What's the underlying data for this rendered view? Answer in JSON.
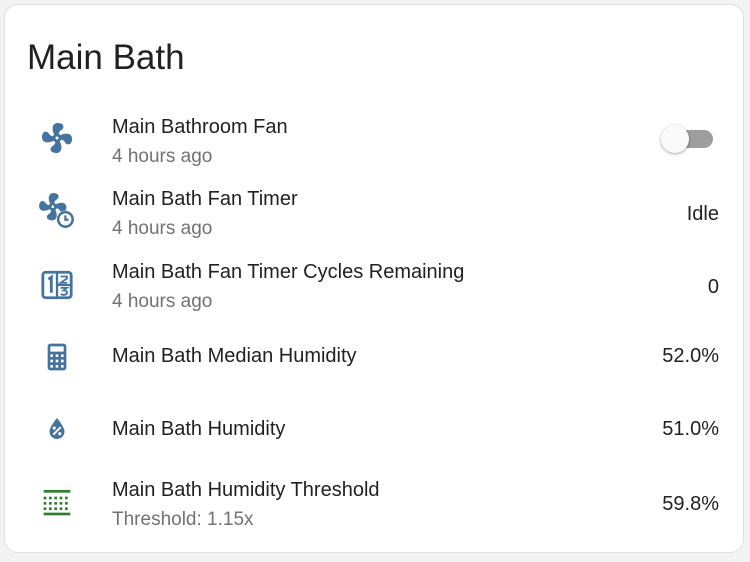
{
  "card": {
    "title": "Main Bath"
  },
  "colors": {
    "icon": "#44739e",
    "threshold_icon": "#2e7d32",
    "text_primary": "#212121",
    "text_secondary": "#727272"
  },
  "entities": [
    {
      "name": "Main Bathroom Fan",
      "secondary": "4 hours ago",
      "icon": "fan-icon",
      "toggle_on": false
    },
    {
      "name": "Main Bath Fan Timer",
      "secondary": "4 hours ago",
      "icon": "fan-clock-icon",
      "value": "Idle"
    },
    {
      "name": "Main Bath Fan Timer Cycles Remaining",
      "secondary": "4 hours ago",
      "icon": "numeric-icon",
      "value": "0"
    },
    {
      "name": "Main Bath Median Humidity",
      "icon": "calculator-icon",
      "value": "52.0%"
    },
    {
      "name": "Main Bath Humidity",
      "icon": "water-percent-icon",
      "value": "51.0%"
    },
    {
      "name": "Main Bath Humidity Threshold",
      "secondary": "Threshold: 1.15x",
      "icon": "threshold-icon",
      "value": "59.8%"
    }
  ]
}
